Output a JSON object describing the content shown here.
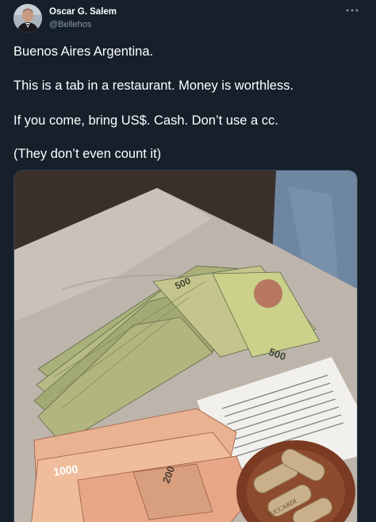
{
  "author": {
    "name": "Oscar G. Salem",
    "handle": "@Bellehos"
  },
  "icons": {
    "more": "more-options-icon"
  },
  "tweet": {
    "lines": [
      "Buenos Aires Argentina.",
      "This is a tab in a restaurant.  Money is worthless.",
      "If you come, bring US$.  Cash.  Don’t use a cc.",
      "(They don’t even count it)"
    ]
  },
  "photo": {
    "banknote_denominations": [
      "500",
      "500",
      "200",
      "1000"
    ],
    "cork_text": "ZUCCARDI"
  },
  "colors": {
    "background": "#15202b",
    "secondary_text": "#8b98a5",
    "primary_text": "#ffffff"
  }
}
